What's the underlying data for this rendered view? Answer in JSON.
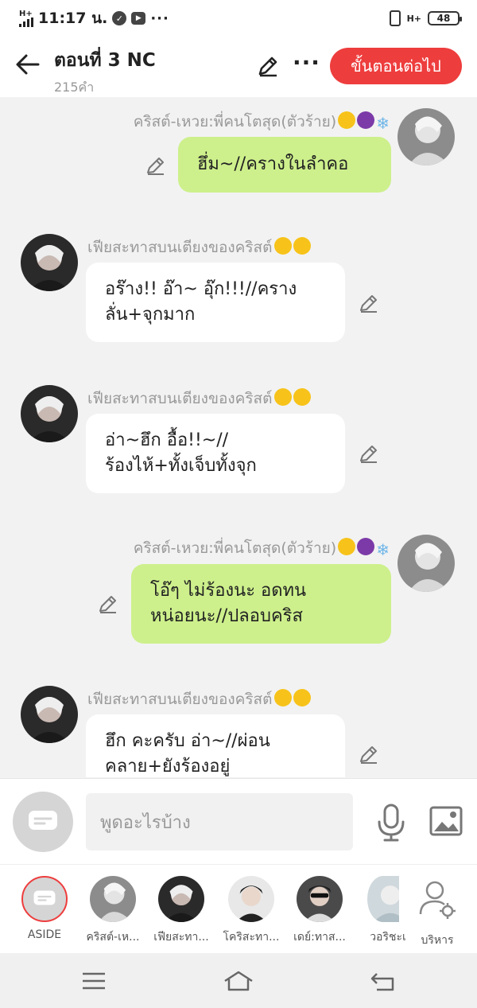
{
  "status_bar": {
    "network": "H+",
    "time": "11:17 น.",
    "more": "···",
    "right_network": "H+",
    "battery": "48"
  },
  "header": {
    "title": "ตอนที่ 3 NC",
    "word_count": "215คำ",
    "next_button": "ขั้นตอนต่อไป"
  },
  "messages": [
    {
      "side": "right",
      "name": "คริสต์-เหวย:พี่คนโตสุด(ตัวร้าย)",
      "emojis": [
        "smile",
        "devil",
        "snow"
      ],
      "lines": [
        "ฮึ่ม~//ครางในลำคอ"
      ],
      "color": "green"
    },
    {
      "side": "left",
      "name": "เฟียสะทาสบนเตียงของคริสต์",
      "emojis": [
        "blush",
        "blush"
      ],
      "lines": [
        "อร๊าง!! อ๊า~ อุ๊ก!!!//คราง",
        "ลั่น+จุกมาก"
      ],
      "color": "white"
    },
    {
      "side": "left",
      "name": "เฟียสะทาสบนเตียงของคริสต์",
      "emojis": [
        "blush",
        "blush"
      ],
      "lines": [
        "อ่า~ฮึก อื้อ!!~//",
        "ร้องไห้+ทั้งเจ็บทั้งจุก"
      ],
      "color": "white"
    },
    {
      "side": "right",
      "name": "คริสต์-เหวย:พี่คนโตสุด(ตัวร้าย)",
      "emojis": [
        "smile",
        "devil",
        "snow"
      ],
      "lines": [
        "โอ๊ๆ ไม่ร้องนะ อดทน",
        "หน่อยนะ//ปลอบคริส"
      ],
      "color": "green"
    },
    {
      "side": "left",
      "name": "เฟียสะทาสบนเตียงของคริสต์",
      "emojis": [
        "blush",
        "blush"
      ],
      "lines": [
        "ฮึก คะครับ อ่า~//ผ่อน",
        "คลาย+ยังร้องอยู่"
      ],
      "color": "white"
    }
  ],
  "input": {
    "placeholder": "พูดอะไรบ้าง"
  },
  "characters": [
    {
      "label": "ASIDE"
    },
    {
      "label": "คริสต์-เห..."
    },
    {
      "label": "เฟียสะทา..."
    },
    {
      "label": "โคริสะทา..."
    },
    {
      "label": "เดย์:ทาส..."
    },
    {
      "label": "วอริชะเ"
    },
    {
      "label": "บริหาร"
    }
  ],
  "colors": {
    "accent": "#ee3d3d",
    "bubble_green": "#cdf08c",
    "bubble_white": "#ffffff",
    "background": "#f2f2f2"
  }
}
